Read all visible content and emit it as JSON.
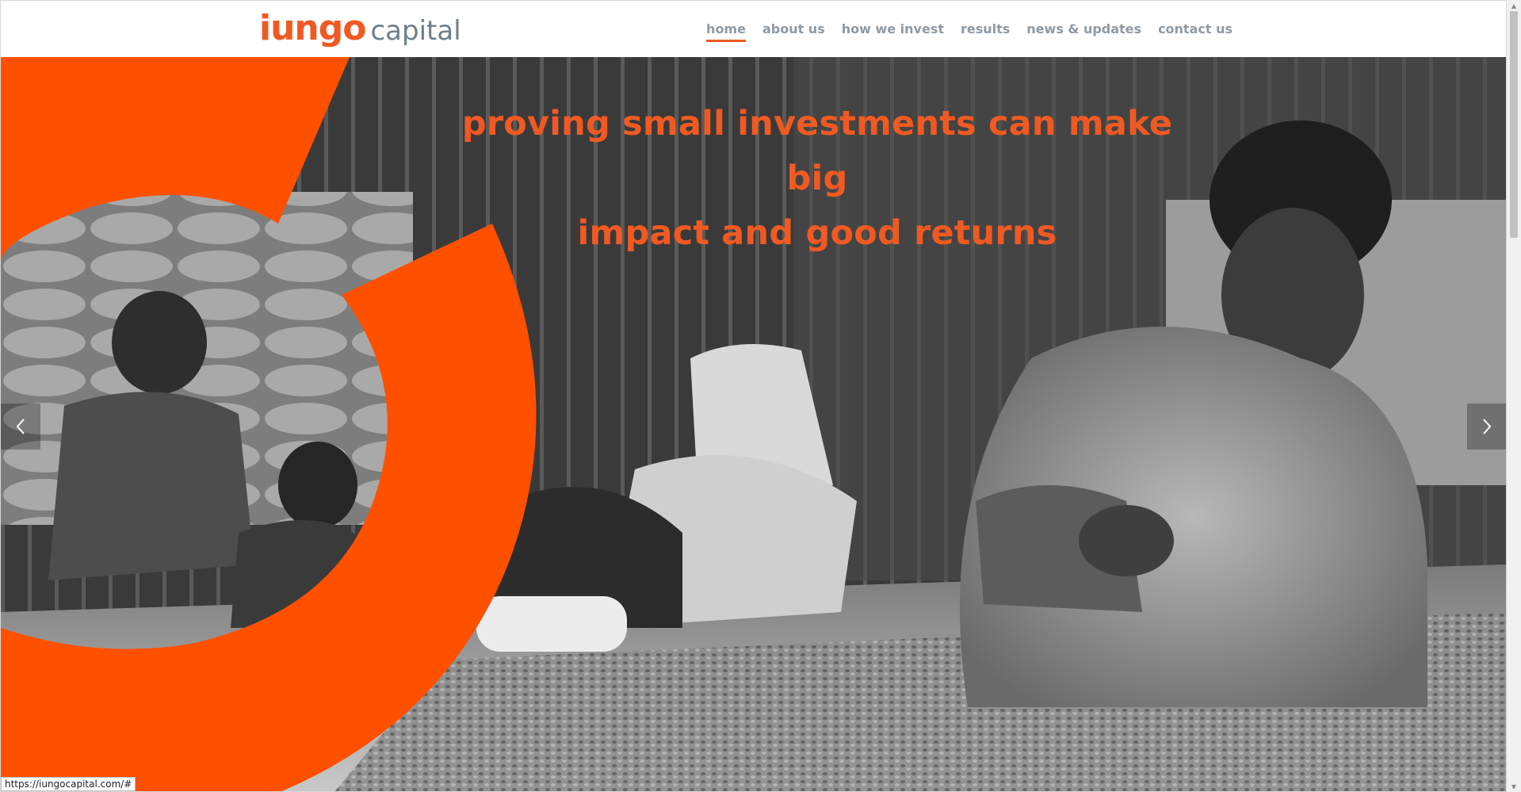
{
  "brand": {
    "name_primary": "iungo",
    "name_secondary": "capital",
    "accent_color": "#f05a22",
    "gray_color": "#6d7f8c"
  },
  "nav": {
    "items": [
      {
        "label": "home",
        "active": true
      },
      {
        "label": "about us"
      },
      {
        "label": "how we invest"
      },
      {
        "label": "results"
      },
      {
        "label": "news & updates"
      },
      {
        "label": "contact us"
      }
    ]
  },
  "hero": {
    "headline_line1": "proving small investments can make big",
    "headline_line2": "impact and good returns",
    "prev_icon": "chevron-left-icon",
    "next_icon": "chevron-right-icon"
  },
  "status_bar": {
    "url": "https://iungocapital.com/#"
  }
}
